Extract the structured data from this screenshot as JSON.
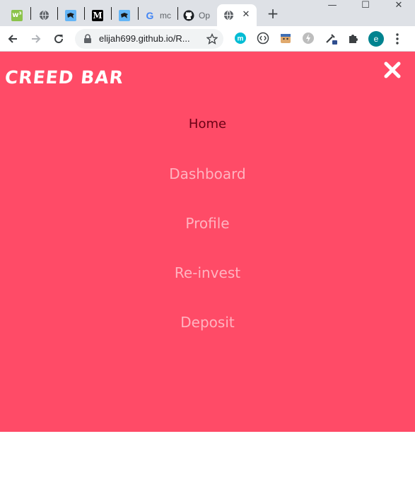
{
  "browser": {
    "tabs": [
      {
        "icon": "w3schools-icon",
        "title": ""
      },
      {
        "icon": "globe-icon",
        "title": ""
      },
      {
        "icon": "bird-icon",
        "title": ""
      },
      {
        "icon": "medium-icon",
        "title": ""
      },
      {
        "icon": "bird-icon",
        "title": ""
      },
      {
        "icon": "google-icon",
        "title": "mc"
      },
      {
        "icon": "github-icon",
        "title": "Op"
      },
      {
        "icon": "globe-icon",
        "title": ""
      }
    ],
    "address": {
      "url": "elijah699.github.io/R..."
    },
    "profile_initial": "e",
    "extension_letter_m": "m",
    "window_controls": {
      "minimize": "—",
      "maximize": "☐",
      "close": "✕"
    }
  },
  "site": {
    "brand": "CREED BAR",
    "menu": [
      {
        "label": "Home",
        "current": true
      },
      {
        "label": "Dashboard",
        "current": false
      },
      {
        "label": "Profile",
        "current": false
      },
      {
        "label": "Re-invest",
        "current": false
      },
      {
        "label": "Deposit",
        "current": false
      }
    ]
  },
  "colors": {
    "overlay": "#ff4b67",
    "current_link": "#6a0014",
    "other_link": "#ffb3c0",
    "brand_text": "#ffffff"
  }
}
